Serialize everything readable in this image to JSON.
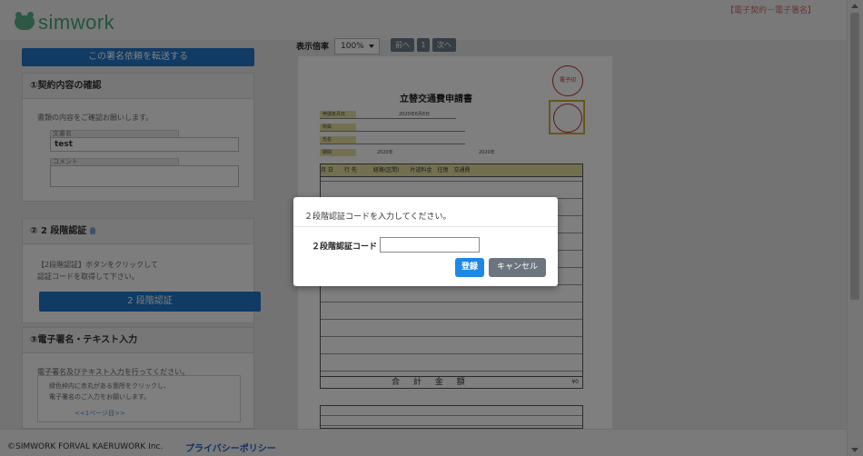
{
  "header": {
    "logo_text": "simwork",
    "top_right_label": "【電子契約－電子署名】"
  },
  "left": {
    "forward_button": "この署名依頼を転送する",
    "panel1": {
      "title": "①契約内容の確認",
      "text": "書類の内容をご確認お願いします。",
      "doc_name_label": "文書名",
      "doc_name_value": "test",
      "comment_label": "コメント"
    },
    "panel2": {
      "title": "② 2 段階認証",
      "text_line1": "【2段階認証】ボタンをクリックして",
      "text_line2": "認証コードを取得して下さい。",
      "button": "2 段階認証"
    },
    "panel3": {
      "title": "③電子署名・テキスト入力",
      "text": "電子署名及びテキスト入力を行ってください。",
      "inner_line1": "緑色枠内に赤丸がある箇所をクリックし、",
      "inner_line2": "電子署名のご入力をお願いします。",
      "page_link": "<<1ページ目>>"
    }
  },
  "toolbar": {
    "zoom_label": "表示倍率",
    "zoom_value": "100%",
    "prev": "前へ",
    "page": "1",
    "next": "次へ"
  },
  "document": {
    "title": "立替交通費申請書",
    "stamp_text": "電子印",
    "date_label": "申請年月日",
    "date_value": "2020年6月8日",
    "dept_label": "所属",
    "name_label": "氏名",
    "period_label": "期間",
    "year1": "2020年",
    "year2": "2020年",
    "table_header": "月 日　　行 先　　　経路(区間)　　片道料金　往復　交通費",
    "total_label": "合 計 金 額",
    "total_value": "¥0"
  },
  "footer": {
    "copyright": "©SIMWORK FORVAL KAERUWORK Inc.",
    "privacy": "プライバシーポリシー"
  },
  "modal": {
    "message": "２段階認証コードを入力してください。",
    "code_label": "２段階認証コード",
    "code_value": "",
    "register_button": "登録",
    "cancel_button": "キャンセル"
  }
}
